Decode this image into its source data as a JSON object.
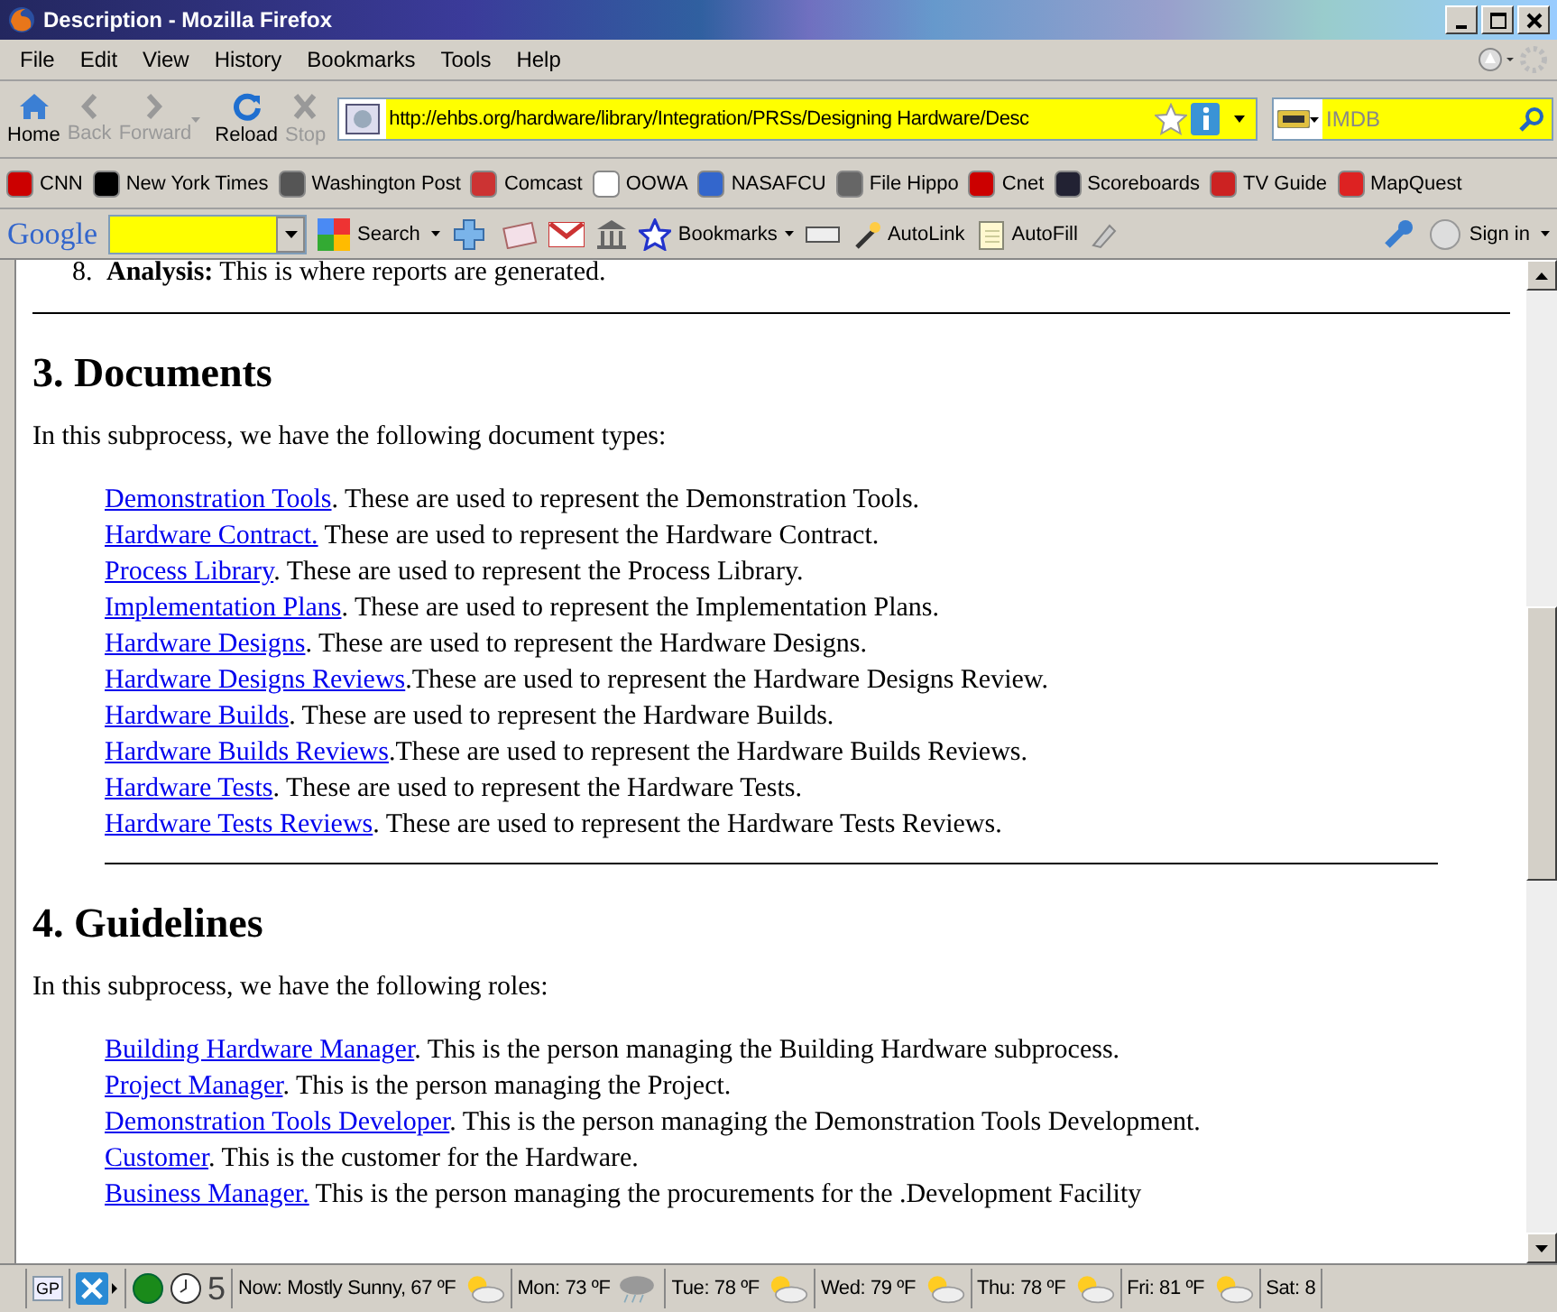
{
  "window": {
    "title": "Description - Mozilla Firefox"
  },
  "menu": [
    "File",
    "Edit",
    "View",
    "History",
    "Bookmarks",
    "Tools",
    "Help"
  ],
  "nav_toolbar": {
    "buttons": [
      {
        "kind": "home",
        "label": "Home",
        "disabled": false
      },
      {
        "kind": "back",
        "label": "Back",
        "disabled": true
      },
      {
        "kind": "forward",
        "label": "Forward",
        "disabled": true
      },
      {
        "kind": "reload",
        "label": "Reload",
        "disabled": false
      },
      {
        "kind": "stop",
        "label": "Stop",
        "disabled": true
      }
    ],
    "address": "http://ehbs.org/hardware/library/Integration/PRSs/Designing Hardware/Desc",
    "search_placeholder": "IMDB"
  },
  "bookmarks": [
    "CNN",
    "New York Times",
    "Washington Post",
    "Comcast",
    "OOWA",
    "NASAFCU",
    "File Hippo",
    "Cnet",
    "Scoreboards",
    "TV Guide",
    "MapQuest"
  ],
  "google_toolbar": {
    "logo": "Google",
    "search": "Search",
    "bookmarks": "Bookmarks",
    "autolink": "AutoLink",
    "autofill": "AutoFill",
    "sign_in": "Sign in"
  },
  "content": {
    "top_item": {
      "number": "8.",
      "term": "Analysis:",
      "text": "This is where reports are generated."
    },
    "sections": [
      {
        "heading": "3. Documents",
        "intro": "In this subprocess, we have the following document types:",
        "items": [
          {
            "link": "Demonstration Tools",
            "text": ". These are used to represent the Demonstration Tools."
          },
          {
            "link": "Hardware Contract.",
            "text": " These are used to represent the Hardware Contract."
          },
          {
            "link": "Process Library",
            "text": ". These are used to represent the Process Library."
          },
          {
            "link": "Implementation Plans",
            "text": ". These are used to represent the Implementation Plans."
          },
          {
            "link": "Hardware Designs",
            "text": ". These are used to represent the Hardware Designs."
          },
          {
            "link": "Hardware Designs Reviews",
            "text": ".These are used to represent the Hardware Designs Review."
          },
          {
            "link": "Hardware Builds",
            "text": ". These are used to represent the Hardware Builds."
          },
          {
            "link": "Hardware Builds Reviews",
            "text": ".These are used to represent the Hardware Builds Reviews."
          },
          {
            "link": "Hardware Tests",
            "text": ". These are used to represent the Hardware Tests."
          },
          {
            "link": "Hardware Tests Reviews",
            "text": ". These are used to represent the Hardware Tests Reviews."
          }
        ]
      },
      {
        "heading": "4. Guidelines",
        "intro": "In this subprocess, we have the following roles:",
        "items": [
          {
            "link": "Building Hardware Manager",
            "text": ". This is the person managing the Building Hardware subprocess."
          },
          {
            "link": "Project Manager",
            "text": ". This is the person managing the Project."
          },
          {
            "link": "Demonstration Tools Developer",
            "text": ". This is the person managing the Demonstration Tools Development."
          },
          {
            "link": "Customer",
            "text": ". This is the customer for the Hardware."
          },
          {
            "link": "Business Manager.",
            "text": " This is the person managing the procurements for the .Development Facility"
          }
        ]
      }
    ]
  },
  "status_bar": {
    "gp": "GP",
    "count": "5",
    "weather": [
      "Now: Mostly Sunny, 67 ºF",
      "Mon: 73 ºF",
      "Tue: 78 ºF",
      "Wed: 79 ºF",
      "Thu: 78 ºF",
      "Fri: 81 ºF",
      "Sat: 8"
    ]
  }
}
